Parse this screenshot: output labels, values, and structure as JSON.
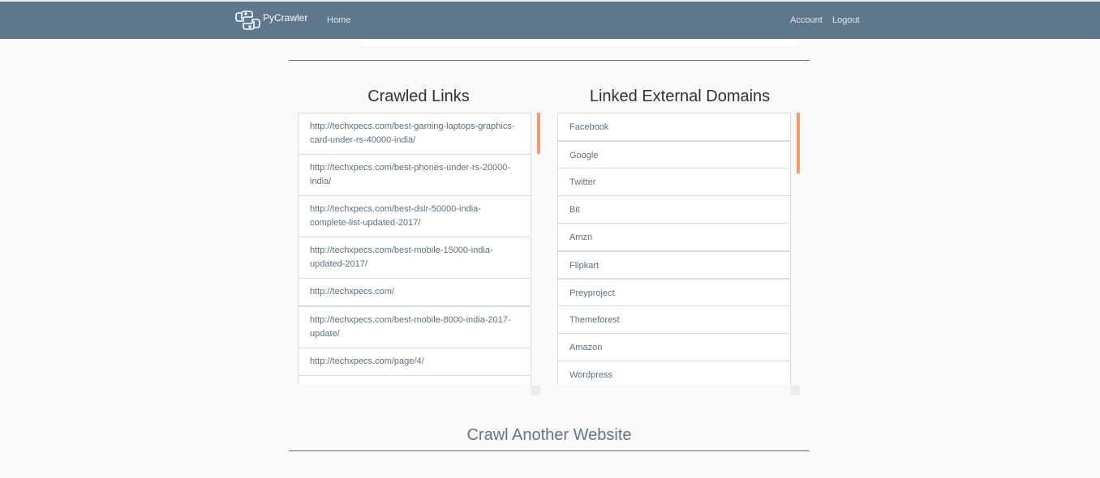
{
  "brand": {
    "name": "PyCrawler",
    "logo_icon": "python-logo-icon"
  },
  "nav": {
    "home": "Home",
    "account": "Account",
    "logout": "Logout"
  },
  "crawled_links": {
    "title": "Crawled Links",
    "items": [
      "http://techxpecs.com/best-gaming-laptops-graphics-card-under-rs-40000-india/",
      "http://techxpecs.com/best-phones-under-rs-20000-india/",
      "http://techxpecs.com/best-dslr-50000-india-complete-list-updated-2017/",
      "http://techxpecs.com/best-mobile-15000-india-updated-2017/",
      "http://techxpecs.com/",
      "http://techxpecs.com/best-mobile-8000-india-2017-update/",
      "http://techxpecs.com/page/4/"
    ]
  },
  "external_domains": {
    "title": "Linked External Domains",
    "items": [
      "Facebook",
      "Google",
      "Twitter",
      "Bit",
      "Amzn",
      "Flipkart",
      "Preyproject",
      "Themeforest",
      "Amazon",
      "Wordpress"
    ]
  },
  "footer": {
    "crawl_another": "Crawl Another Website"
  },
  "colors": {
    "navbar": "#5f778b",
    "scroll_thumb": "#ef9a6f",
    "link_text": "#5e7081"
  }
}
